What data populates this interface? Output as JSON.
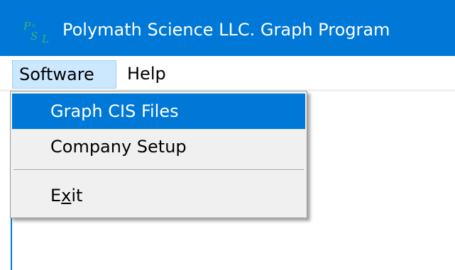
{
  "window": {
    "title": "Polymath Science LLC. Graph Program",
    "icon": "psl-logo-icon",
    "accent_color": "#0078d7"
  },
  "menubar": {
    "items": [
      {
        "label": "Software",
        "state": "open"
      },
      {
        "label": "Help"
      }
    ]
  },
  "software_menu": {
    "items": [
      {
        "label": "Graph CIS Files",
        "highlighted": true
      },
      {
        "label": "Company Setup"
      },
      {
        "label_prefix": "E",
        "label_mnemonic": "x",
        "label_suffix": "it",
        "mnemonic": "x"
      }
    ]
  }
}
